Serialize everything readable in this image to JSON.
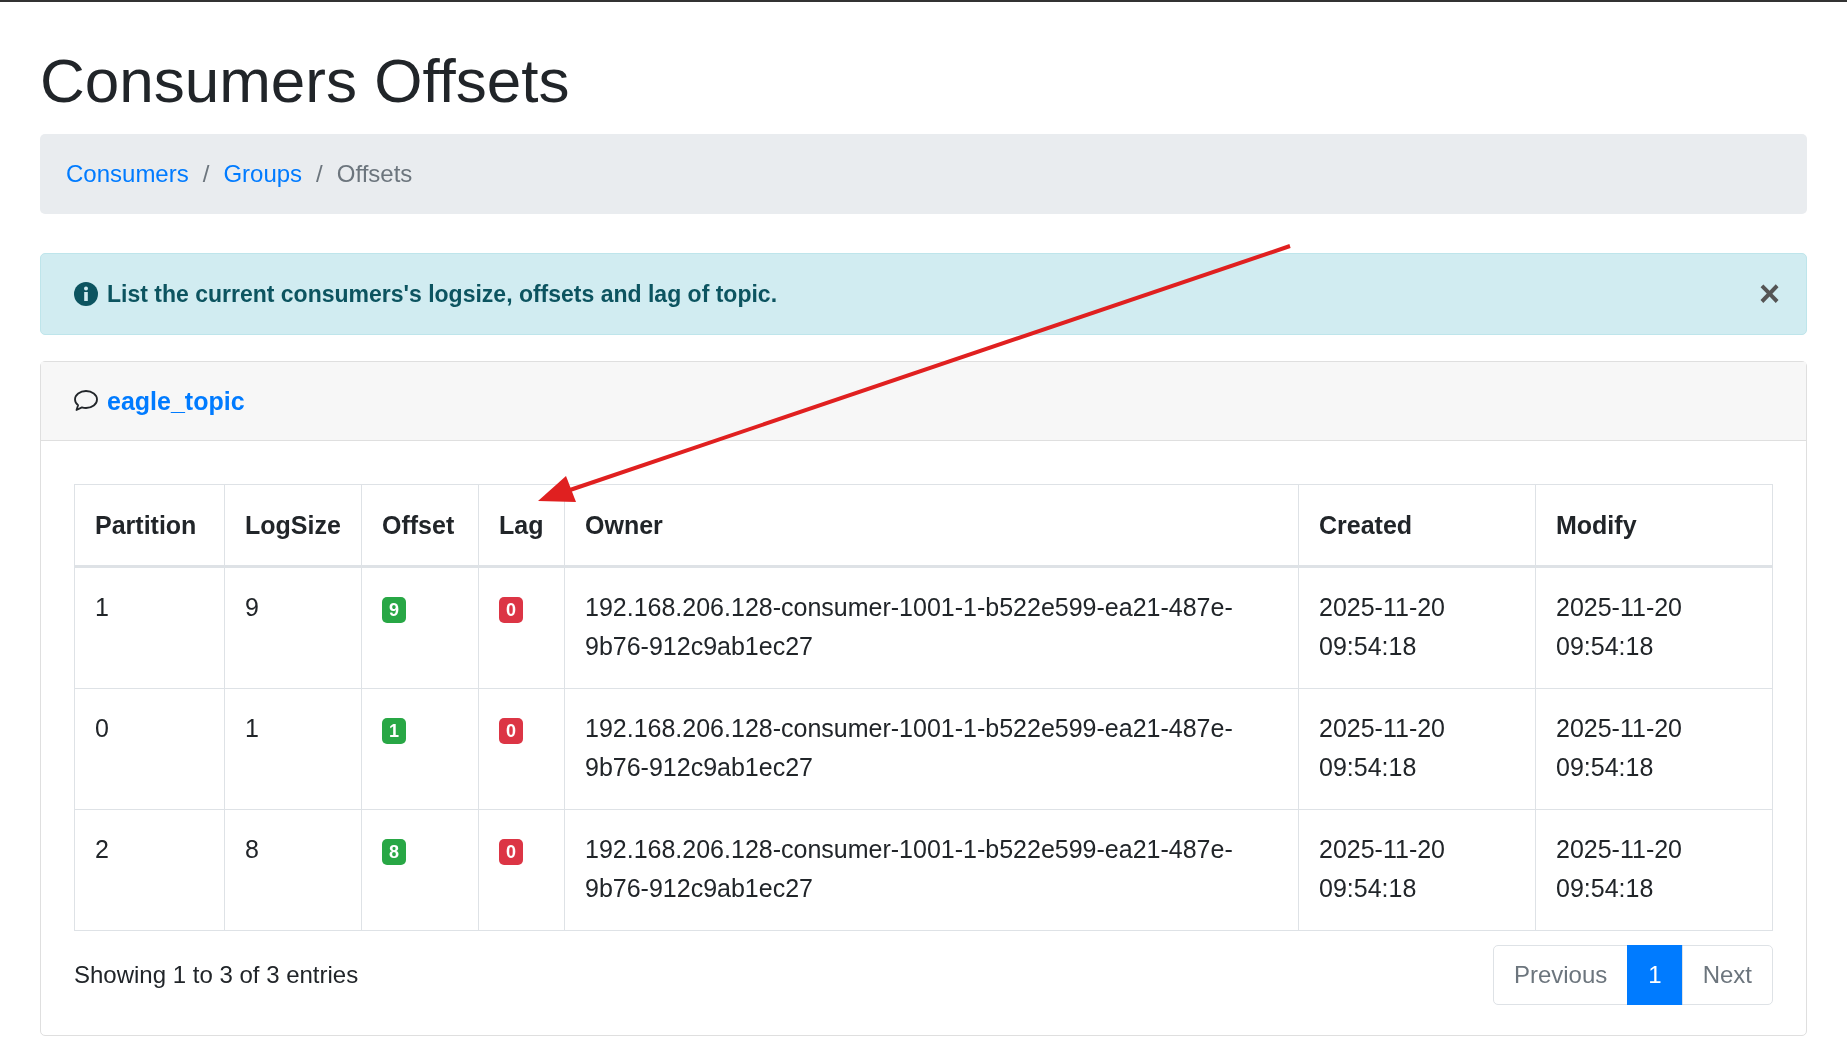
{
  "page_title": "Consumers Offsets",
  "breadcrumb": [
    {
      "label": "Consumers",
      "kind": "link"
    },
    {
      "label": "Groups",
      "kind": "link"
    },
    {
      "label": "Offsets",
      "kind": "current"
    }
  ],
  "breadcrumb_separator": "/",
  "alert": {
    "text": "List the current consumers's logsize, offsets and lag of topic.",
    "close": "×"
  },
  "card": {
    "topic": "eagle_topic"
  },
  "table": {
    "columns": [
      "Partition",
      "LogSize",
      "Offset",
      "Lag",
      "Owner",
      "Created",
      "Modify"
    ],
    "rows": [
      [
        {
          "text": "1",
          "kind": "plain"
        },
        {
          "text": "9",
          "kind": "plain"
        },
        {
          "text": "9",
          "kind": "success"
        },
        {
          "text": "0",
          "kind": "danger"
        },
        {
          "text": "192.168.206.128-consumer-1001-1-b522e599-ea21-487e-9b76-912c9ab1ec27",
          "kind": "plain"
        },
        {
          "text": "2025-11-20 09:54:18",
          "kind": "plain"
        },
        {
          "text": "2025-11-20 09:54:18",
          "kind": "plain"
        }
      ],
      [
        {
          "text": "0",
          "kind": "plain"
        },
        {
          "text": "1",
          "kind": "plain"
        },
        {
          "text": "1",
          "kind": "success"
        },
        {
          "text": "0",
          "kind": "danger"
        },
        {
          "text": "192.168.206.128-consumer-1001-1-b522e599-ea21-487e-9b76-912c9ab1ec27",
          "kind": "plain"
        },
        {
          "text": "2025-11-20 09:54:18",
          "kind": "plain"
        },
        {
          "text": "2025-11-20 09:54:18",
          "kind": "plain"
        }
      ],
      [
        {
          "text": "2",
          "kind": "plain"
        },
        {
          "text": "8",
          "kind": "plain"
        },
        {
          "text": "8",
          "kind": "success"
        },
        {
          "text": "0",
          "kind": "danger"
        },
        {
          "text": "192.168.206.128-consumer-1001-1-b522e599-ea21-487e-9b76-912c9ab1ec27",
          "kind": "plain"
        },
        {
          "text": "2025-11-20 09:54:18",
          "kind": "plain"
        },
        {
          "text": "2025-11-20 09:54:18",
          "kind": "plain"
        }
      ]
    ]
  },
  "info": "Showing 1 to 3 of 3 entries",
  "pagination": [
    {
      "label": "Previous",
      "selected": false
    },
    {
      "label": "1",
      "selected": true
    },
    {
      "label": "Next",
      "selected": false
    }
  ]
}
